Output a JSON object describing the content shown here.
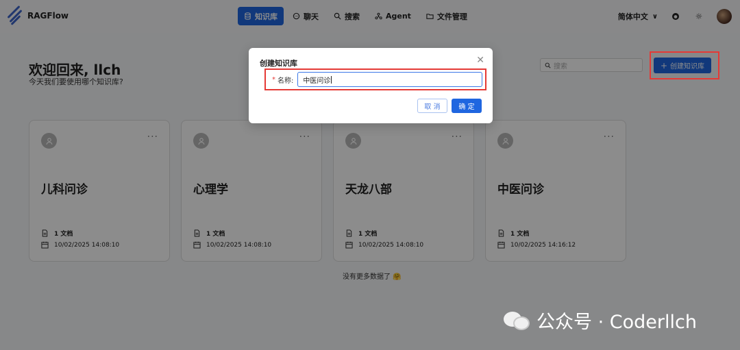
{
  "app": {
    "name": "RAGFlow"
  },
  "nav": [
    {
      "label": "知识库",
      "icon": "database-icon",
      "active": true
    },
    {
      "label": "聊天",
      "icon": "chat-icon",
      "active": false
    },
    {
      "label": "搜索",
      "icon": "search-icon",
      "active": false
    },
    {
      "label": "Agent",
      "icon": "agent-icon",
      "active": false
    },
    {
      "label": "文件管理",
      "icon": "folder-icon",
      "active": false
    }
  ],
  "header": {
    "language": "简体中文"
  },
  "main": {
    "welcome": "欢迎回来, llch",
    "subtitle": "今天我们要使用哪个知识库?",
    "search_placeholder": "搜索",
    "create_label": "创建知识库",
    "no_more": "没有更多数据了 🤗"
  },
  "cards": [
    {
      "title": "儿科问诊",
      "docs": "1 文档",
      "date": "10/02/2025 14:08:10"
    },
    {
      "title": "心理学",
      "docs": "1 文档",
      "date": "10/02/2025 14:08:10"
    },
    {
      "title": "天龙八部",
      "docs": "1 文档",
      "date": "10/02/2025 14:08:10"
    },
    {
      "title": "中医问诊",
      "docs": "1 文档",
      "date": "10/02/2025 14:16:12"
    }
  ],
  "modal": {
    "title": "创建知识库",
    "field_label": "名称:",
    "field_value": "中医问诊",
    "cancel": "取 消",
    "ok": "确 定"
  },
  "watermark": "公众号 · Coderllch",
  "colors": {
    "primary": "#1f66e0",
    "highlight": "#e53935"
  }
}
